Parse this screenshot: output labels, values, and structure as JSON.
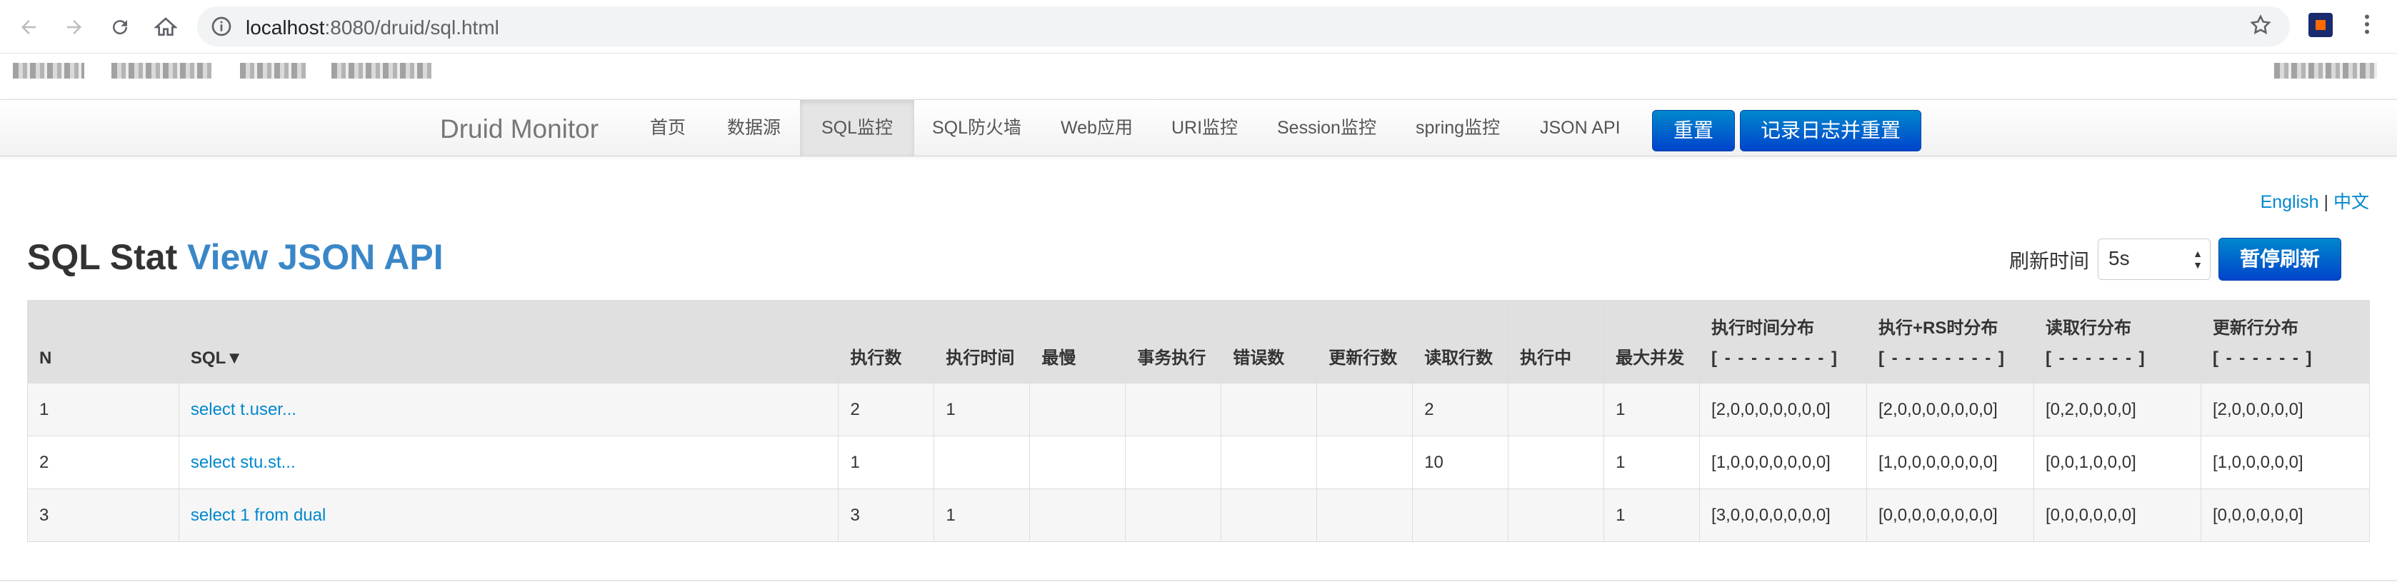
{
  "browser": {
    "url_host": "localhost",
    "url_rest": ":8080/druid/sql.html"
  },
  "navbar": {
    "brand": "Druid Monitor",
    "items": [
      {
        "label": "首页"
      },
      {
        "label": "数据源"
      },
      {
        "label": "SQL监控",
        "active": true
      },
      {
        "label": "SQL防火墙"
      },
      {
        "label": "Web应用"
      },
      {
        "label": "URI监控"
      },
      {
        "label": "Session监控"
      },
      {
        "label": "spring监控"
      },
      {
        "label": "JSON API"
      }
    ],
    "reset_label": "重置",
    "log_reset_label": "记录日志并重置"
  },
  "lang": {
    "english": "English",
    "separator": "|",
    "chinese": "中文"
  },
  "page": {
    "title": "SQL Stat",
    "json_link": "View JSON API",
    "refresh_label": "刷新时间",
    "refresh_value": "5s",
    "pause_label": "暂停刷新"
  },
  "table": {
    "headers": [
      {
        "label": "N"
      },
      {
        "label": "SQL▼"
      },
      {
        "label": "执行数"
      },
      {
        "label": "执行时间"
      },
      {
        "label": "最慢"
      },
      {
        "label": "事务执行"
      },
      {
        "label": "错误数"
      },
      {
        "label": "更新行数"
      },
      {
        "label": "读取行数"
      },
      {
        "label": "执行中"
      },
      {
        "label": "最大并发"
      },
      {
        "label": "执行时间分布",
        "sub": "[ - - - - - - - - ]"
      },
      {
        "label": "执行+RS时分布",
        "sub": "[ - - - - - - - - ]"
      },
      {
        "label": "读取行分布",
        "sub": "[ - - - - - - ]"
      },
      {
        "label": "更新行分布",
        "sub": "[ - - - - - - ]"
      }
    ],
    "rows": [
      {
        "n": "1",
        "sql": "select t.user...",
        "exec": "2",
        "time": "1",
        "slowest": "",
        "txn": "",
        "errors": "",
        "updated": "",
        "read": "2",
        "running": "",
        "max_conc": "1",
        "time_hist": "[2,0,0,0,0,0,0,0]",
        "rs_hist": "[2,0,0,0,0,0,0,0]",
        "read_hist": "[0,2,0,0,0,0]",
        "update_hist": "[2,0,0,0,0,0]"
      },
      {
        "n": "2",
        "sql": "select stu.st...",
        "exec": "1",
        "time": "",
        "slowest": "",
        "txn": "",
        "errors": "",
        "updated": "",
        "read": "10",
        "running": "",
        "max_conc": "1",
        "time_hist": "[1,0,0,0,0,0,0,0]",
        "rs_hist": "[1,0,0,0,0,0,0,0]",
        "read_hist": "[0,0,1,0,0,0]",
        "update_hist": "[1,0,0,0,0,0]"
      },
      {
        "n": "3",
        "sql": "select 1 from dual",
        "exec": "3",
        "time": "1",
        "slowest": "",
        "txn": "",
        "errors": "",
        "updated": "",
        "read": "",
        "running": "",
        "max_conc": "1",
        "time_hist": "[3,0,0,0,0,0,0,0]",
        "rs_hist": "[0,0,0,0,0,0,0,0]",
        "read_hist": "[0,0,0,0,0,0]",
        "update_hist": "[0,0,0,0,0,0]"
      }
    ]
  }
}
